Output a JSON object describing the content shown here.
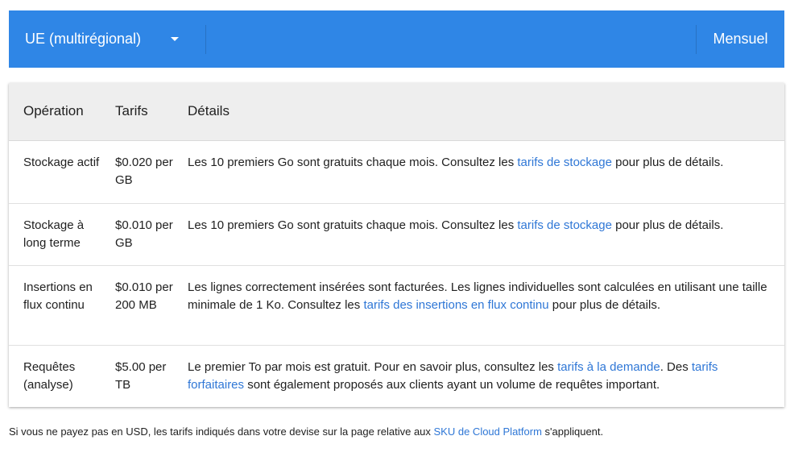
{
  "toolbar": {
    "region_label": "UE (multirégional)",
    "period_label": "Mensuel"
  },
  "table": {
    "headers": [
      "Opération",
      "Tarifs",
      "Détails"
    ],
    "rows": [
      {
        "operation": "Stockage actif",
        "price": "$0.020 per GB",
        "details": [
          {
            "text": "Les 10 premiers Go sont gratuits chaque mois. Consultez les "
          },
          {
            "link": "tarifs de stockage"
          },
          {
            "text": " pour plus de détails."
          }
        ]
      },
      {
        "operation": "Stockage à long terme",
        "price": "$0.010 per GB",
        "details": [
          {
            "text": "Les 10 premiers Go sont gratuits chaque mois. Consultez les "
          },
          {
            "link": "tarifs de stockage"
          },
          {
            "text": " pour plus de détails."
          }
        ]
      },
      {
        "operation": "Insertions en flux continu",
        "price": "$0.010 per 200 MB",
        "details": [
          {
            "text": "Les lignes correctement insérées sont facturées. Les lignes individuelles sont calculées en utilisant une taille minimale de 1 Ko. Consultez les "
          },
          {
            "link": "tarifs des insertions en flux continu"
          },
          {
            "text": " pour plus de détails."
          }
        ]
      },
      {
        "operation": "Requêtes (analyse)",
        "price": "$5.00 per TB",
        "details": [
          {
            "text": "Le premier To par mois est gratuit. Pour en savoir plus, consultez les "
          },
          {
            "link": "tarifs à la demande"
          },
          {
            "text": ". Des "
          },
          {
            "link": "tarifs forfaitaires"
          },
          {
            "text": " sont également proposés aux clients ayant un volume de requêtes important."
          }
        ]
      }
    ]
  },
  "footnote": {
    "before": "Si vous ne payez pas en USD, les tarifs indiqués dans votre devise sur la page relative aux ",
    "link": "SKU de Cloud Platform",
    "after": " s'appliquent."
  },
  "colors": {
    "toolbar_bg": "#2f86e6",
    "link": "#2f77d6",
    "header_bg": "#eeeeee"
  }
}
